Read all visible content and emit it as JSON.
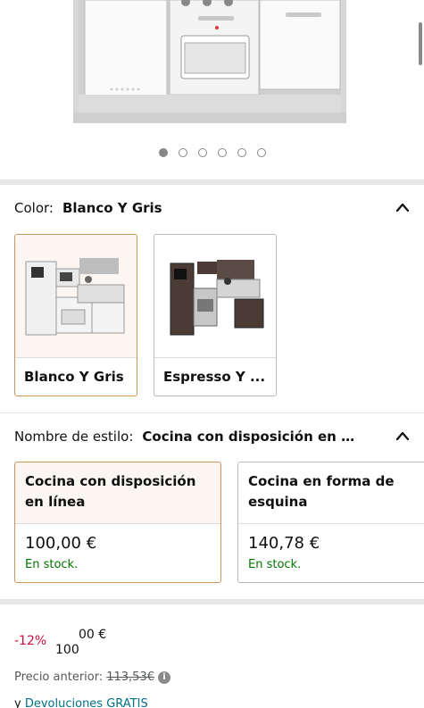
{
  "hero": {
    "image_label": "product-image-kitchen-white-gray",
    "dots_count": 6,
    "active_dot": 0
  },
  "color_section": {
    "label": "Color:",
    "value": "Blanco Y Gris",
    "options": [
      {
        "name": "Blanco Y Gris",
        "selected": true
      },
      {
        "name": "Espresso Y ...",
        "selected": false
      }
    ]
  },
  "style_section": {
    "label": "Nombre de estilo:",
    "value": "Cocina con disposición en l...",
    "options": [
      {
        "title": "Cocina con disposición en línea",
        "price": "100,00 €",
        "stock": "En stock.",
        "selected": true
      },
      {
        "title": "Cocina en forma de esquina",
        "price": "140,78 €",
        "stock": "En stock.",
        "selected": false
      }
    ]
  },
  "price": {
    "discount": "-12%",
    "whole": "100",
    "fraction": "00 €",
    "previous_label": "Precio anterior:",
    "previous_value": "113,53€",
    "returns_prefix": "y",
    "returns_link": "Devoluciones GRATIS"
  },
  "colors": {
    "accent_border": "#c9975b",
    "stock_green": "#007600",
    "discount_red": "#cc0c39",
    "link_teal": "#007185"
  }
}
